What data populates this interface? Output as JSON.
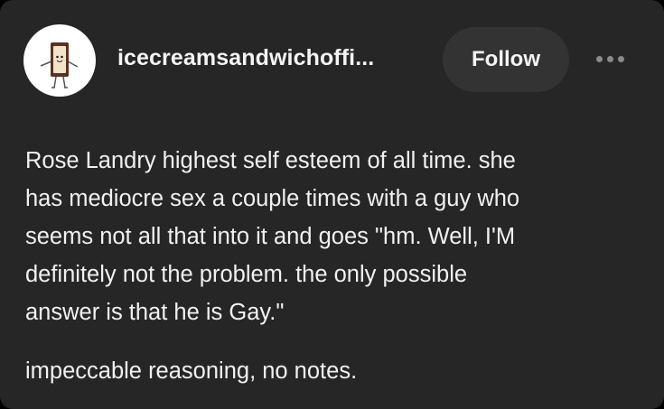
{
  "post": {
    "username": "icecreamsandwichoffi...",
    "follow_label": "Follow",
    "more_icon": "more-horizontal-icon",
    "avatar_icon": "ice-cream-sandwich-mascot",
    "body_lines": [
      "Rose Landry highest self esteem of all time. she",
      "has mediocre sex a couple times with a guy who",
      "seems not all that into it and goes \"hm. Well, I'M",
      "definitely not the problem. the only possible",
      "answer is that he is Gay.\""
    ],
    "paragraph2": "impeccable reasoning, no notes."
  },
  "colors": {
    "card_background": "#262626",
    "follow_button_background": "#333333",
    "text": "#f1f1f1"
  }
}
